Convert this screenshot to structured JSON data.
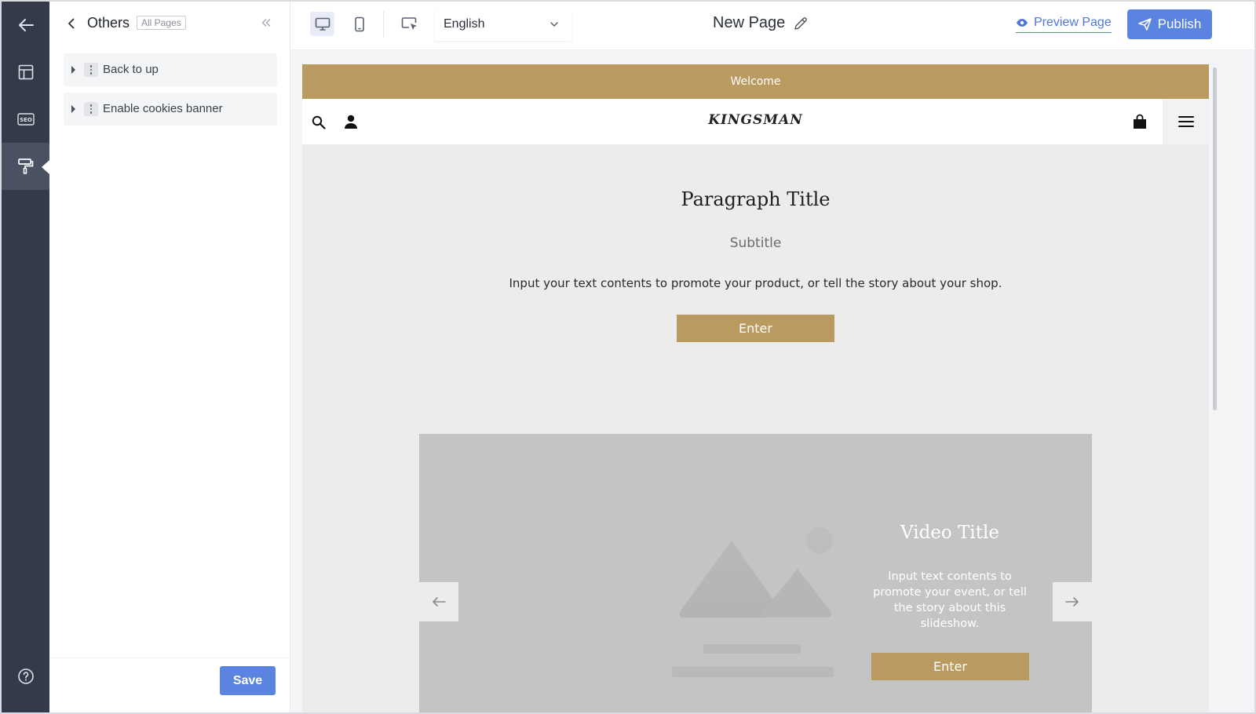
{
  "rail": {
    "icons": [
      "arrow-left-icon",
      "layout-icon",
      "seo-icon",
      "paint-roller-icon",
      "help-icon"
    ],
    "seo_text": "SEO"
  },
  "panel": {
    "title": "Others",
    "tag": "All Pages",
    "items": [
      {
        "label": "Back to up"
      },
      {
        "label": "Enable cookies banner"
      }
    ],
    "save_label": "Save"
  },
  "toolbar": {
    "language": "English",
    "page_title": "New Page",
    "preview_label": "Preview Page",
    "publish_label": "Publish"
  },
  "site": {
    "welcome": "Welcome",
    "brand": "KINGSMAN",
    "paragraph_title": "Paragraph Title",
    "subtitle": "Subtitle",
    "body_text": "Input your text contents to promote your product, or tell the story about your shop.",
    "enter_label": "Enter",
    "slideshow": {
      "title": "Video Title",
      "text": "Input text contents to promote your event, or tell the story about this slideshow.",
      "enter_label": "Enter"
    }
  },
  "colors": {
    "accent": "#5b83e0",
    "brand_gold": "#b99a60",
    "rail": "#343a49"
  }
}
